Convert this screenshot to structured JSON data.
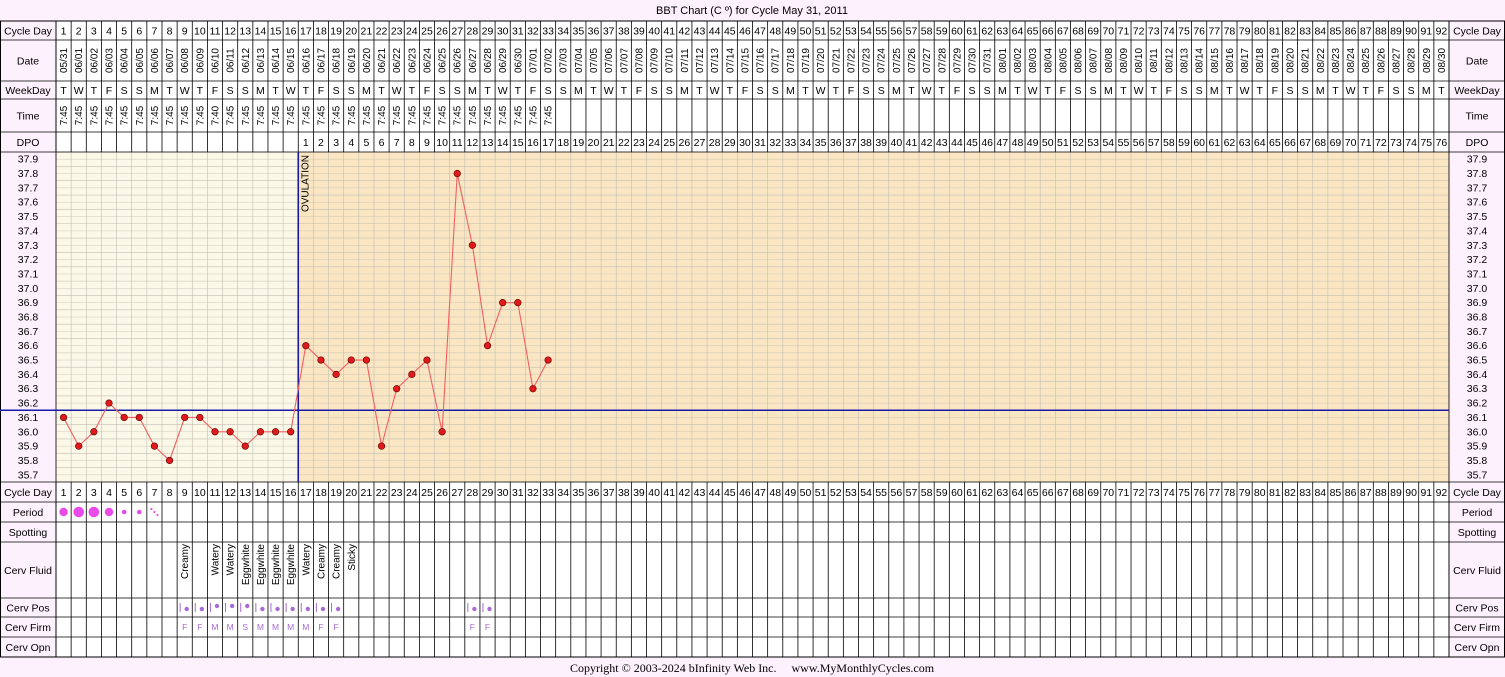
{
  "title": "BBT Chart (C º) for Cycle May 31, 2011",
  "copyright": "Copyright © 2003-2024 bInfinity Web Inc.     www.MyMonthlyCycles.com",
  "ovulation_label": "OVULATION",
  "row_labels": {
    "cycle_day": "Cycle Day",
    "date": "Date",
    "weekday": "WeekDay",
    "time": "Time",
    "dpo": "DPO",
    "period": "Period",
    "spotting": "Spotting",
    "cerv_fluid": "Cerv Fluid",
    "cerv_pos": "Cerv Pos",
    "cerv_firm": "Cerv Firm",
    "cerv_opn": "Cerv Opn"
  },
  "cycle_days": [
    "1",
    "2",
    "3",
    "4",
    "5",
    "6",
    "7",
    "8",
    "9",
    "10",
    "11",
    "12",
    "13",
    "14",
    "15",
    "16",
    "17",
    "18",
    "19",
    "20",
    "21",
    "22",
    "23",
    "24",
    "25",
    "26",
    "27",
    "28",
    "29",
    "30",
    "31",
    "32",
    "33",
    "34",
    "35",
    "36",
    "37",
    "38",
    "39",
    "40",
    "41",
    "42",
    "43",
    "44",
    "45",
    "46",
    "47",
    "48",
    "49",
    "50",
    "51",
    "52",
    "53",
    "54",
    "55",
    "56",
    "57",
    "58",
    "59",
    "60",
    "61",
    "62",
    "63",
    "64",
    "65",
    "66",
    "67",
    "68",
    "69",
    "70",
    "71",
    "72",
    "73",
    "74",
    "75",
    "76",
    "77",
    "78",
    "79",
    "80",
    "81",
    "82",
    "83",
    "84",
    "85",
    "86",
    "87",
    "88",
    "89",
    "90",
    "91",
    "92"
  ],
  "dates": [
    "05/31",
    "06/01",
    "06/02",
    "06/03",
    "06/04",
    "06/05",
    "06/06",
    "06/07",
    "06/08",
    "06/09",
    "06/10",
    "06/11",
    "06/12",
    "06/13",
    "06/14",
    "06/15",
    "06/16",
    "06/17",
    "06/18",
    "06/19",
    "06/20",
    "06/21",
    "06/22",
    "06/23",
    "06/24",
    "06/25",
    "06/26",
    "06/27",
    "06/28",
    "06/29",
    "06/30",
    "07/01",
    "07/02",
    "07/03",
    "07/04",
    "07/05",
    "07/06",
    "07/07",
    "07/08",
    "07/09",
    "07/10",
    "07/11",
    "07/12",
    "07/13",
    "07/14",
    "07/15",
    "07/16",
    "07/17",
    "07/18",
    "07/19",
    "07/20",
    "07/21",
    "07/22",
    "07/23",
    "07/24",
    "07/25",
    "07/26",
    "07/27",
    "07/28",
    "07/29",
    "07/30",
    "07/31",
    "08/01",
    "08/02",
    "08/03",
    "08/04",
    "08/05",
    "08/06",
    "08/07",
    "08/08",
    "08/09",
    "08/10",
    "08/11",
    "08/12",
    "08/13",
    "08/14",
    "08/15",
    "08/16",
    "08/17",
    "08/18",
    "08/19",
    "08/20",
    "08/21",
    "08/22",
    "08/23",
    "08/24",
    "08/25",
    "08/26",
    "08/27",
    "08/28",
    "08/29",
    "08/30"
  ],
  "weekdays": [
    "T",
    "W",
    "T",
    "F",
    "S",
    "S",
    "M",
    "T",
    "W",
    "T",
    "F",
    "S",
    "S",
    "M",
    "T",
    "W",
    "T",
    "F",
    "S",
    "S",
    "M",
    "T",
    "W",
    "T",
    "F",
    "S",
    "S",
    "M",
    "T",
    "W",
    "T",
    "F",
    "S",
    "S",
    "M",
    "T",
    "W",
    "T",
    "F",
    "S",
    "S",
    "M",
    "T",
    "W",
    "T",
    "F",
    "S",
    "S",
    "M",
    "T",
    "W",
    "T",
    "F",
    "S",
    "S",
    "M",
    "T",
    "W",
    "T",
    "F",
    "S",
    "S",
    "M",
    "T",
    "W",
    "T",
    "F",
    "S",
    "S",
    "M",
    "T",
    "W",
    "T",
    "F",
    "S",
    "S",
    "M",
    "T",
    "W",
    "T",
    "F",
    "S",
    "S",
    "M",
    "T",
    "W",
    "T",
    "F",
    "S",
    "S",
    "M",
    "T"
  ],
  "times": [
    "7:45",
    "7:45",
    "7:45",
    "7:45",
    "7:45",
    "7:45",
    "7:45",
    "7:45",
    "7:45",
    "7:45",
    "7:40",
    "7:45",
    "7:45",
    "7:45",
    "7:45",
    "7:45",
    "7:45",
    "7:45",
    "7:45",
    "7:45",
    "7:45",
    "7:45",
    "7:45",
    "7:45",
    "7:45",
    "7:45",
    "7:45",
    "7:45",
    "7:45",
    "7:45",
    "7:45",
    "7:45",
    "7:45"
  ],
  "dpo": [
    "",
    "",
    "",
    "",
    "",
    "",
    "",
    "",
    "",
    "",
    "",
    "",
    "",
    "",
    "",
    "",
    "1",
    "2",
    "3",
    "4",
    "5",
    "6",
    "7",
    "8",
    "9",
    "10",
    "11",
    "12",
    "13",
    "14",
    "15",
    "16",
    "17",
    "18",
    "19",
    "20",
    "21",
    "22",
    "23",
    "24",
    "25",
    "26",
    "27",
    "28",
    "29",
    "30",
    "31",
    "32",
    "33",
    "34",
    "35",
    "36",
    "37",
    "38",
    "39",
    "40",
    "41",
    "42",
    "43",
    "44",
    "45",
    "46",
    "47",
    "48",
    "49",
    "50",
    "51",
    "52",
    "53",
    "54",
    "55",
    "56",
    "57",
    "58",
    "59",
    "60",
    "61",
    "62",
    "63",
    "64",
    "65",
    "66",
    "67",
    "68",
    "69",
    "70",
    "71",
    "72",
    "73",
    "74",
    "75",
    "76"
  ],
  "period": [
    "medium",
    "heavy",
    "heavy",
    "medium",
    "light",
    "light",
    "spotting",
    "",
    "",
    "",
    "",
    "",
    "",
    "",
    "",
    "",
    "",
    "",
    "",
    "",
    "",
    "",
    "",
    "",
    "",
    "",
    "",
    "",
    "",
    "",
    "",
    "",
    "",
    "",
    "",
    "",
    "",
    "",
    "",
    "",
    "",
    "",
    "",
    "",
    "",
    "",
    "",
    "",
    "",
    "",
    "",
    "",
    "",
    "",
    "",
    "",
    "",
    "",
    "",
    "",
    "",
    "",
    "",
    "",
    "",
    "",
    "",
    "",
    "",
    "",
    "",
    "",
    "",
    "",
    "",
    "",
    "",
    "",
    "",
    "",
    "",
    "",
    "",
    "",
    "",
    "",
    "",
    "",
    "",
    "",
    "",
    "",
    ""
  ],
  "cerv_fluid": [
    "",
    "",
    "",
    "",
    "",
    "",
    "",
    "",
    "Creamy",
    "",
    "Watery",
    "Watery",
    "Eggwhite",
    "Eggwhite",
    "Eggwhite",
    "Eggwhite",
    "Watery",
    "Creamy",
    "Creamy",
    "Sticky"
  ],
  "cerv_pos": [
    "",
    "",
    "",
    "",
    "",
    "",
    "",
    "",
    "low",
    "low",
    "medium",
    "medium",
    "medium",
    "low",
    "low",
    "low",
    "low",
    "low",
    "low",
    "",
    "",
    "",
    "",
    "",
    "",
    "",
    "",
    "low",
    "low"
  ],
  "cerv_firm": [
    "",
    "",
    "",
    "",
    "",
    "",
    "",
    "",
    "F",
    "F",
    "M",
    "M",
    "S",
    "M",
    "M",
    "M",
    "M",
    "F",
    "F",
    "",
    "",
    "",
    "",
    "",
    "",
    "",
    "",
    "F",
    "F"
  ],
  "colors": {
    "background": "#fdf1fd",
    "pre_ovulation_fill": "#fcf8e8",
    "post_ovulation_fill": "#fbe6c3",
    "grid": "#c2bfb3",
    "line": "#f26060",
    "point": "#e01a1a",
    "marker_line": "#1a1aa6",
    "period": "#e84be8",
    "cervix": "#a86bd6"
  },
  "chart_data": {
    "type": "line",
    "title": "BBT Chart (C º) for Cycle May 31, 2011",
    "xlabel": "Cycle Day",
    "ylabel": "",
    "xlim": [
      1,
      92
    ],
    "ylim": [
      35.7,
      37.9
    ],
    "yticks": [
      "37.9",
      "37.8",
      "37.7",
      "37.6",
      "37.5",
      "37.4",
      "37.3",
      "37.2",
      "37.1",
      "37.0",
      "36.9",
      "36.8",
      "36.7",
      "36.6",
      "36.5",
      "36.4",
      "36.3",
      "36.2",
      "36.1",
      "36.0",
      "35.9",
      "35.8",
      "35.7"
    ],
    "grid": true,
    "ovulation_day": 16,
    "coverline": 36.15,
    "series": [
      {
        "x": [
          1,
          2,
          3,
          4,
          5,
          6,
          7,
          8,
          9,
          10,
          11,
          12,
          13,
          14,
          15,
          16,
          17,
          18,
          19,
          20,
          21,
          22,
          23,
          24,
          25,
          26,
          27,
          28,
          29,
          30,
          31,
          32,
          33
        ],
        "values": [
          36.1,
          35.9,
          36.0,
          36.2,
          36.1,
          36.1,
          35.9,
          35.8,
          36.1,
          36.1,
          36.0,
          36.0,
          35.9,
          36.0,
          36.0,
          36.0,
          36.6,
          36.5,
          36.4,
          36.5,
          36.5,
          35.9,
          36.3,
          36.4,
          36.5,
          36.0,
          37.8,
          37.3,
          36.6,
          36.9,
          36.9,
          36.3,
          36.5
        ]
      }
    ]
  }
}
